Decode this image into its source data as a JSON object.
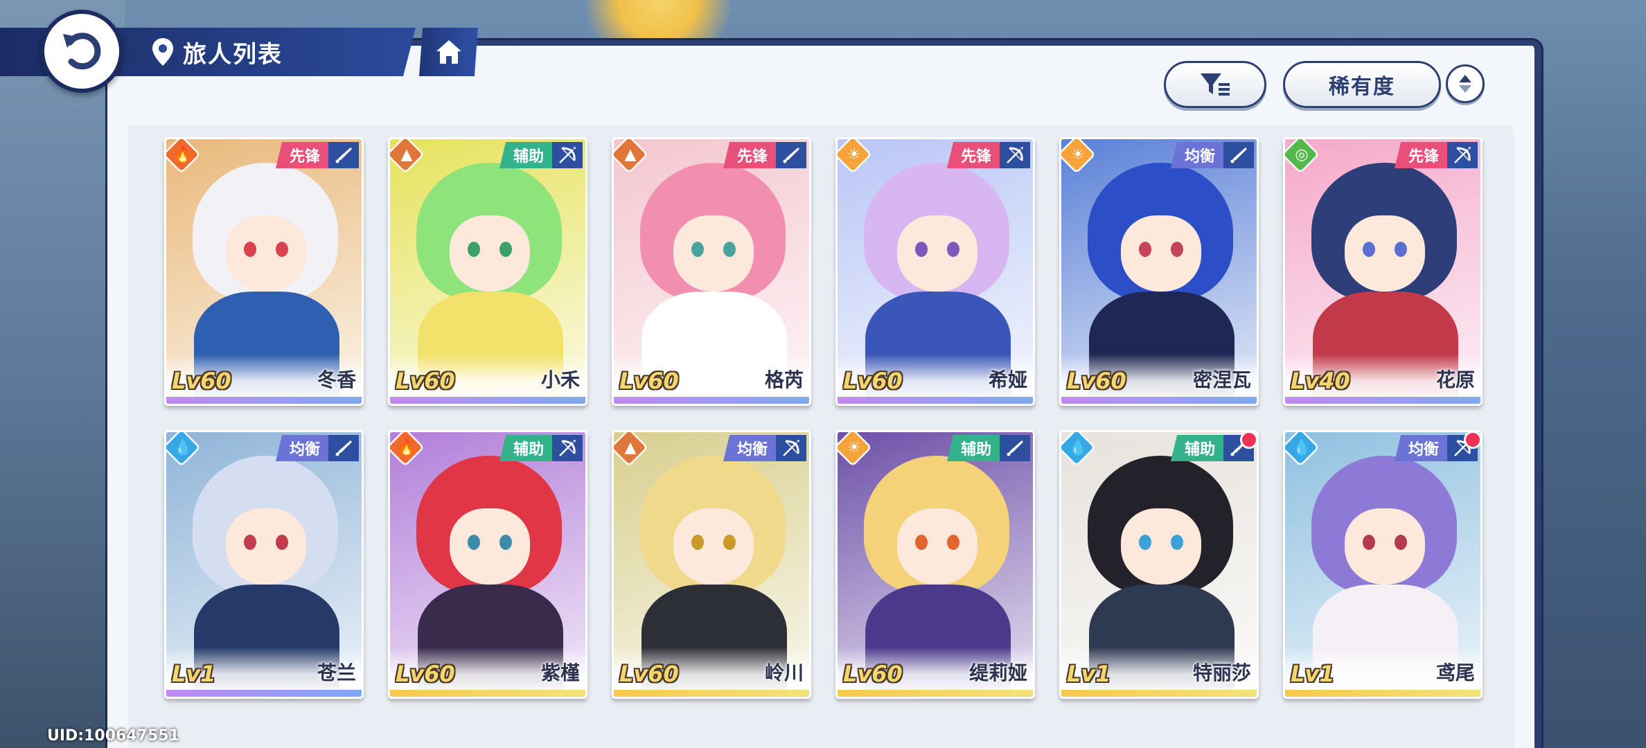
{
  "header": {
    "title": "旅人列表"
  },
  "controls": {
    "rarity_label": "稀有度"
  },
  "uid": "UID:100647551",
  "colors": {
    "fire": "#f06a2e",
    "earth": "#e0773a",
    "light": "#f5a33a",
    "wind": "#55b84a",
    "water": "#37a8e6",
    "vanguard": "#e8507a",
    "support": "#34b28a",
    "balanced": "#6b74d6"
  },
  "cards": [
    {
      "name": "冬香",
      "level": "Lv60",
      "role": "先锋",
      "element": "fire",
      "weapon": "sword",
      "hair": "#f1f1f6",
      "eye": "#d9434f",
      "outfit": "#2f5fb0",
      "bg": "#e9b87a",
      "strip": "purple",
      "dot": false
    },
    {
      "name": "小禾",
      "level": "Lv60",
      "role": "辅助",
      "element": "earth",
      "weapon": "bow",
      "hair": "#8ee37a",
      "eye": "#3da06b",
      "outfit": "#f2e16a",
      "bg": "#e6e25c",
      "strip": "purple",
      "dot": false
    },
    {
      "name": "格芮",
      "level": "Lv60",
      "role": "先锋",
      "element": "earth",
      "weapon": "sword",
      "hair": "#f28fb0",
      "eye": "#4aa39a",
      "outfit": "#ffffff",
      "bg": "#f4c6cf",
      "strip": "purple",
      "dot": false
    },
    {
      "name": "希娅",
      "level": "Lv60",
      "role": "先锋",
      "element": "light",
      "weapon": "bow",
      "hair": "#d8b6f2",
      "eye": "#7e58b8",
      "outfit": "#3a56b8",
      "bg": "#b9c6f5",
      "strip": "purple",
      "dot": false
    },
    {
      "name": "密涅瓦",
      "level": "Lv60",
      "role": "均衡",
      "element": "light",
      "weapon": "sword",
      "hair": "#2c4fc7",
      "eye": "#c6445a",
      "outfit": "#1f2854",
      "bg": "#5a80d6",
      "strip": "purple",
      "dot": false
    },
    {
      "name": "花原",
      "level": "Lv40",
      "role": "先锋",
      "element": "wind",
      "weapon": "bow",
      "hair": "#2d3e78",
      "eye": "#5b6fd0",
      "outfit": "#c23a4a",
      "bg": "#f4a8c8",
      "strip": "purple",
      "dot": false
    },
    {
      "name": "苍兰",
      "level": "Lv1",
      "role": "均衡",
      "element": "water",
      "weapon": "sword",
      "hair": "#d4def0",
      "eye": "#c43c4c",
      "outfit": "#263a6a",
      "bg": "#8fb4d8",
      "strip": "purple",
      "dot": false
    },
    {
      "name": "紫槿",
      "level": "Lv60",
      "role": "辅助",
      "element": "fire",
      "weapon": "bow",
      "hair": "#e03646",
      "eye": "#3b8ca8",
      "outfit": "#3a2b4c",
      "bg": "#b27ed9",
      "strip": "gold",
      "dot": false
    },
    {
      "name": "岭川",
      "level": "Lv60",
      "role": "均衡",
      "element": "earth",
      "weapon": "bow",
      "hair": "#f0d98a",
      "eye": "#c99a2a",
      "outfit": "#2d2f36",
      "bg": "#d8cf8e",
      "strip": "gold",
      "dot": false
    },
    {
      "name": "缇莉娅",
      "level": "Lv60",
      "role": "辅助",
      "element": "light",
      "weapon": "sword",
      "hair": "#f4d27a",
      "eye": "#e3642c",
      "outfit": "#4b3a8c",
      "bg": "#6d4fa8",
      "strip": "gold",
      "dot": false
    },
    {
      "name": "特丽莎",
      "level": "Lv1",
      "role": "辅助",
      "element": "water",
      "weapon": "sword",
      "hair": "#232129",
      "eye": "#3aa2d8",
      "outfit": "#2e3952",
      "bg": "#e6e2dc",
      "strip": "gold",
      "dot": true
    },
    {
      "name": "鸢尾",
      "level": "Lv1",
      "role": "均衡",
      "element": "water",
      "weapon": "bow",
      "hair": "#8c7ad6",
      "eye": "#b63a4e",
      "outfit": "#f4f0f6",
      "bg": "#8fc0e0",
      "strip": "gold",
      "dot": true
    }
  ]
}
